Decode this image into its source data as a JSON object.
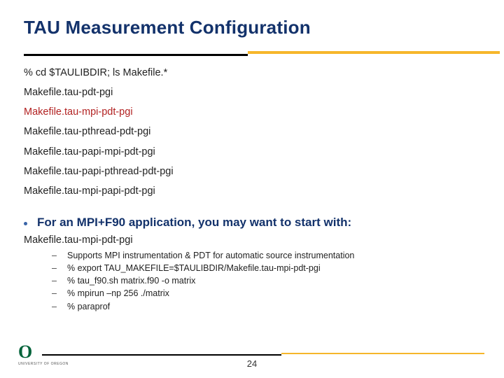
{
  "title": "TAU Measurement Configuration",
  "command": "% cd $TAULIBDIR; ls Makefile.*",
  "makefiles": [
    "Makefile.tau-pdt-pgi",
    "Makefile.tau-mpi-pdt-pgi",
    "Makefile.tau-pthread-pdt-pgi",
    "Makefile.tau-papi-mpi-pdt-pgi",
    "Makefile.tau-papi-pthread-pdt-pgi",
    "Makefile.tau-mpi-papi-pdt-pgi"
  ],
  "highlight_index": 1,
  "bullet": "For an MPI+F90 application, you may want to start with:",
  "sub_heading": "Makefile.tau-mpi-pdt-pgi",
  "sub_items": [
    "Supports MPI instrumentation & PDT for automatic source instrumentation",
    "% export TAU_MAKEFILE=$TAULIBDIR/Makefile.tau-mpi-pdt-pgi",
    "% tau_f90.sh matrix.f90 -o matrix",
    "% mpirun –np 256 ./matrix",
    "% paraprof"
  ],
  "logo": {
    "mark": "O",
    "sub": "UNIVERSITY OF OREGON"
  },
  "page": "24"
}
